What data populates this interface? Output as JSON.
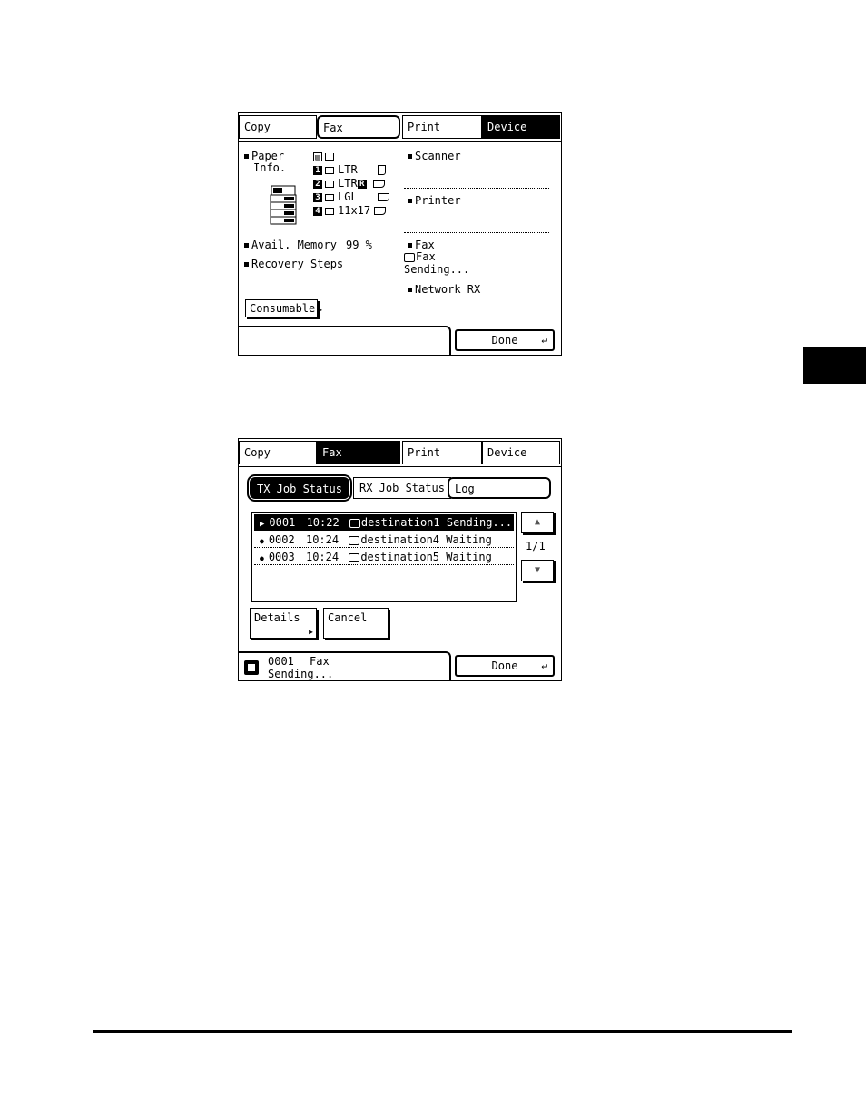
{
  "screen1": {
    "tabs": [
      "Copy",
      "Fax",
      "Print",
      "Device"
    ],
    "paper_info_label_1": "Paper",
    "paper_info_label_2": "Info.",
    "trays": [
      {
        "slot": "1",
        "size": "LTR"
      },
      {
        "slot": "2",
        "size": "LTR"
      },
      {
        "slot": "3",
        "size": "LGL"
      },
      {
        "slot": "4",
        "size": "11x17"
      }
    ],
    "slot2_badge": "R",
    "avail_memory_label": "Avail. Memory",
    "avail_memory_value": "99 %",
    "recovery_steps_label": "Recovery Steps",
    "consumable_label": "Consumable",
    "scanner_label": "Scanner",
    "printer_label": "Printer",
    "fax_label": "Fax",
    "fax_status_line1": "Fax",
    "fax_status_line2": "Sending...",
    "network_rx_label": "Network RX",
    "done_label": "Done"
  },
  "screen2": {
    "tabs": [
      "Copy",
      "Fax",
      "Print",
      "Device"
    ],
    "subtabs": [
      "TX Job Status",
      "RX Job Status",
      "Log"
    ],
    "jobs": [
      {
        "marker": "▶",
        "id": "0001",
        "time": "10:22",
        "dest": "destination1",
        "status": "Sending..."
      },
      {
        "marker": "●",
        "id": "0002",
        "time": "10:24",
        "dest": "destination4",
        "status": "Waiting"
      },
      {
        "marker": "●",
        "id": "0003",
        "time": "10:24",
        "dest": "destination5",
        "status": "Waiting"
      }
    ],
    "page": "1/1",
    "details_label": "Details",
    "cancel_label": "Cancel",
    "status_id": "0001",
    "status_type": "Fax",
    "status_text": "Sending...",
    "done_label": "Done",
    "up_icon": "up-arrow-icon",
    "down_icon": "down-arrow-icon"
  }
}
